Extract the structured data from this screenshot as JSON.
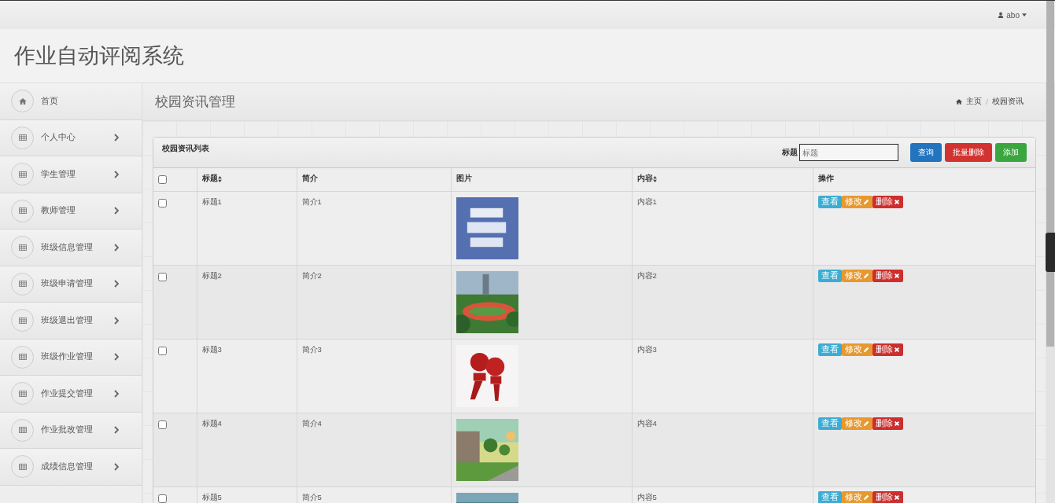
{
  "top_bar": {
    "user": "abo"
  },
  "header": {
    "title": "作业自动评阅系统"
  },
  "sidebar": {
    "items": [
      {
        "label": "首页",
        "kind": "link"
      },
      {
        "label": "个人中心",
        "kind": "group"
      },
      {
        "label": "学生管理",
        "kind": "group"
      },
      {
        "label": "教师管理",
        "kind": "group"
      },
      {
        "label": "班级信息管理",
        "kind": "group"
      },
      {
        "label": "班级申请管理",
        "kind": "group"
      },
      {
        "label": "班级退出管理",
        "kind": "group"
      },
      {
        "label": "班级作业管理",
        "kind": "group"
      },
      {
        "label": "作业提交管理",
        "kind": "group"
      },
      {
        "label": "作业批改管理",
        "kind": "group"
      },
      {
        "label": "成绩信息管理",
        "kind": "group"
      }
    ]
  },
  "page_header": {
    "title": "校园资讯管理",
    "breadcrumb": [
      "主页",
      "/",
      "校园资讯"
    ]
  },
  "panel": {
    "title": "校园资讯列表",
    "search": {
      "label": "标题",
      "placeholder": "标题"
    },
    "buttons": [
      {
        "label": "查询",
        "kind": "primary"
      },
      {
        "label": "批量删除",
        "kind": "danger"
      },
      {
        "label": "添加",
        "kind": "success"
      }
    ],
    "table": {
      "select_all_checked": false,
      "columns": [
        {
          "label": "标题",
          "sortable": true
        },
        {
          "label": "简介",
          "sortable": false
        },
        {
          "label": "图片",
          "sortable": false
        },
        {
          "label": "内容",
          "sortable": true
        },
        {
          "label": "操作",
          "sortable": false
        }
      ],
      "rows": [
        {
          "checked": false,
          "title": "标题1",
          "intro": "简介1",
          "content": "内容1",
          "actions": [
            {
              "label": "查看",
              "kind": "view"
            },
            {
              "label": "修改",
              "kind": "edit"
            },
            {
              "label": "删除",
              "kind": "delete"
            }
          ]
        },
        {
          "checked": false,
          "title": "标题2",
          "intro": "简介2",
          "content": "内容2",
          "actions": [
            {
              "label": "查看",
              "kind": "view"
            },
            {
              "label": "修改",
              "kind": "edit"
            },
            {
              "label": "删除",
              "kind": "delete"
            }
          ]
        },
        {
          "checked": false,
          "title": "标题3",
          "intro": "简介3",
          "content": "内容3",
          "actions": [
            {
              "label": "查看",
              "kind": "view"
            },
            {
              "label": "修改",
              "kind": "edit"
            },
            {
              "label": "删除",
              "kind": "delete"
            }
          ]
        },
        {
          "checked": false,
          "title": "标题4",
          "intro": "简介4",
          "content": "内容4",
          "actions": [
            {
              "label": "查看",
              "kind": "view"
            },
            {
              "label": "修改",
              "kind": "edit"
            },
            {
              "label": "删除",
              "kind": "delete"
            }
          ]
        },
        {
          "checked": false,
          "title": "标题5",
          "intro": "简介5",
          "content": "内容5",
          "actions": [
            {
              "label": "查看",
              "kind": "view"
            },
            {
              "label": "修改",
              "kind": "edit"
            },
            {
              "label": "删除",
              "kind": "delete"
            }
          ]
        }
      ]
    }
  }
}
